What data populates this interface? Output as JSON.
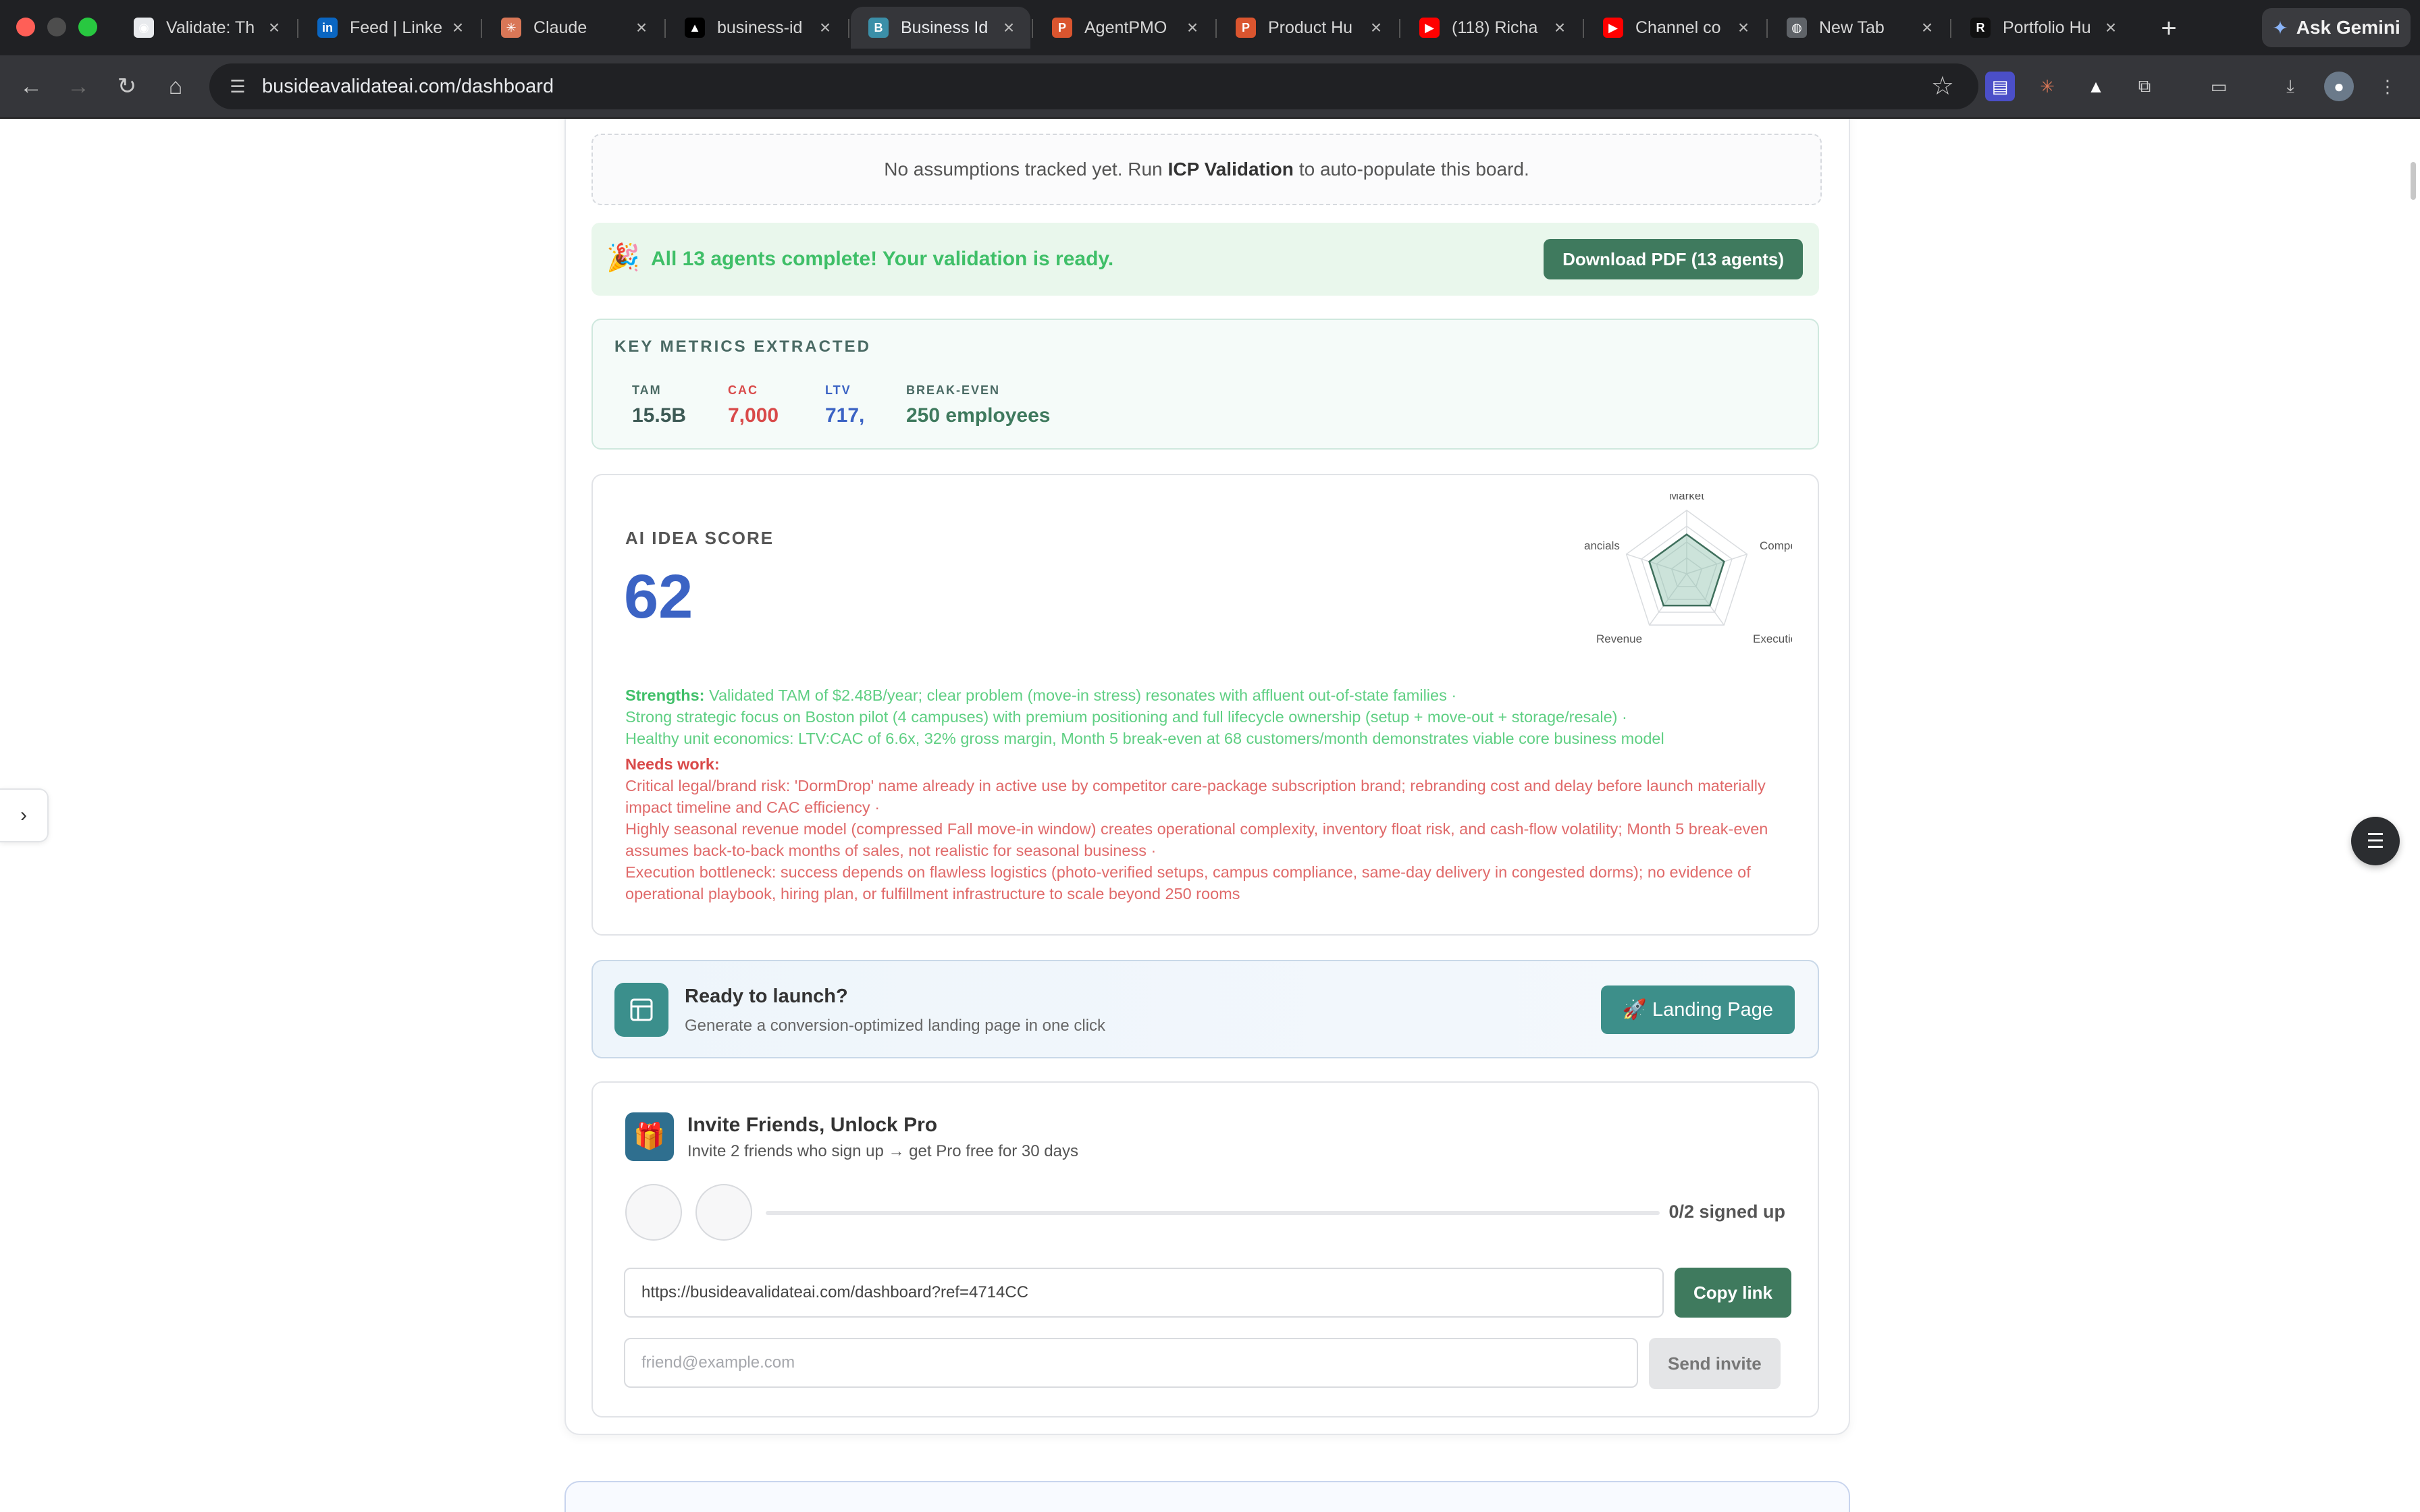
{
  "browser": {
    "tabs": [
      {
        "title": "Validate: Th",
        "fav_color": "#e8eaed",
        "fav_text": "◉"
      },
      {
        "title": "Feed | Linke",
        "fav_color": "#0a66c2",
        "fav_text": "in"
      },
      {
        "title": "Claude",
        "fav_color": "#d97757",
        "fav_text": "✳"
      },
      {
        "title": "business-id",
        "fav_color": "#000000",
        "fav_text": "▲"
      },
      {
        "title": "Business Id",
        "fav_color": "#3b8fa8",
        "fav_text": "B"
      },
      {
        "title": "AgentPMO",
        "fav_color": "#da552f",
        "fav_text": "P"
      },
      {
        "title": "Product Hu",
        "fav_color": "#da552f",
        "fav_text": "P"
      },
      {
        "title": "(118) Richa",
        "fav_color": "#ff0000",
        "fav_text": "▶"
      },
      {
        "title": "Channel co",
        "fav_color": "#ff0000",
        "fav_text": "▶"
      },
      {
        "title": "New Tab",
        "fav_color": "#5f6368",
        "fav_text": "◍"
      },
      {
        "title": "Portfolio Hu",
        "fav_color": "#111111",
        "fav_text": "R"
      }
    ],
    "active_tab_index": 4,
    "gemini_label": "Ask Gemini",
    "url": "busideavalidateai.com/dashboard"
  },
  "assumptions": {
    "text_before": "No assumptions tracked yet. Run",
    "bold": "ICP Validation",
    "text_after": "to auto-populate this board."
  },
  "completion": {
    "emoji": "🎉",
    "message": "All 13 agents complete! Your validation is ready.",
    "download_label": "Download PDF (13 agents)"
  },
  "metrics": {
    "header": "KEY METRICS EXTRACTED",
    "items": [
      {
        "label": "TAM",
        "value": "15.5B",
        "label_color": "#4a6a64",
        "value_color": "#3d5a55"
      },
      {
        "label": "CAC",
        "value": "7,000",
        "label_color": "#d94a4a",
        "value_color": "#d94a4a"
      },
      {
        "label": "LTV",
        "value": "717,",
        "label_color": "#3b63c4",
        "value_color": "#3b63c4"
      },
      {
        "label": "BREAK-EVEN",
        "value": "250 employees",
        "label_color": "#4a6a64",
        "value_color": "#3f7a5e"
      }
    ]
  },
  "score": {
    "title": "AI IDEA SCORE",
    "value": "62",
    "radar_axes": [
      "Market",
      "Compe",
      "Execution",
      "Revenue",
      "ancials"
    ],
    "strengths_label": "Strengths:",
    "strengths": [
      "Validated TAM of $2.48B/year; clear problem (move-in stress) resonates with affluent out-of-state families ·",
      "Strong strategic focus on Boston pilot (4 campuses) with premium positioning and full lifecycle ownership (setup + move-out + storage/resale) ·",
      "Healthy unit economics: LTV:CAC of 6.6x, 32% gross margin, Month 5 break-even at 68 customers/month demonstrates viable core business model"
    ],
    "needs_label": "Needs work:",
    "needs": [
      "Critical legal/brand risk: 'DormDrop' name already in active use by competitor care-package subscription brand; rebranding cost and delay before launch materially impact timeline and CAC efficiency ·",
      "Highly seasonal revenue model (compressed Fall move-in window) creates operational complexity, inventory float risk, and cash-flow volatility; Month 5 break-even assumes back-to-back months of sales, not realistic for seasonal business ·",
      "Execution bottleneck: success depends on flawless logistics (photo-verified setups, campus compliance, same-day delivery in congested dorms); no evidence of operational playbook, hiring plan, or fulfillment infrastructure to scale beyond 250 rooms"
    ]
  },
  "launch": {
    "title": "Ready to launch?",
    "subtitle": "Generate a conversion-optimized landing page in one click",
    "button": "🚀 Landing Page"
  },
  "invite": {
    "emoji": "🎁",
    "title": "Invite Friends, Unlock Pro",
    "subtitle": "Invite 2 friends who sign up → get Pro free for 30 days",
    "progress_fraction": 0,
    "signed_label": "0/2 signed up",
    "link_value": "https://busideavalidateai.com/dashboard?ref=4714CC",
    "copy_label": "Copy link",
    "email_placeholder": "friend@example.com",
    "send_label": "Send invite"
  }
}
